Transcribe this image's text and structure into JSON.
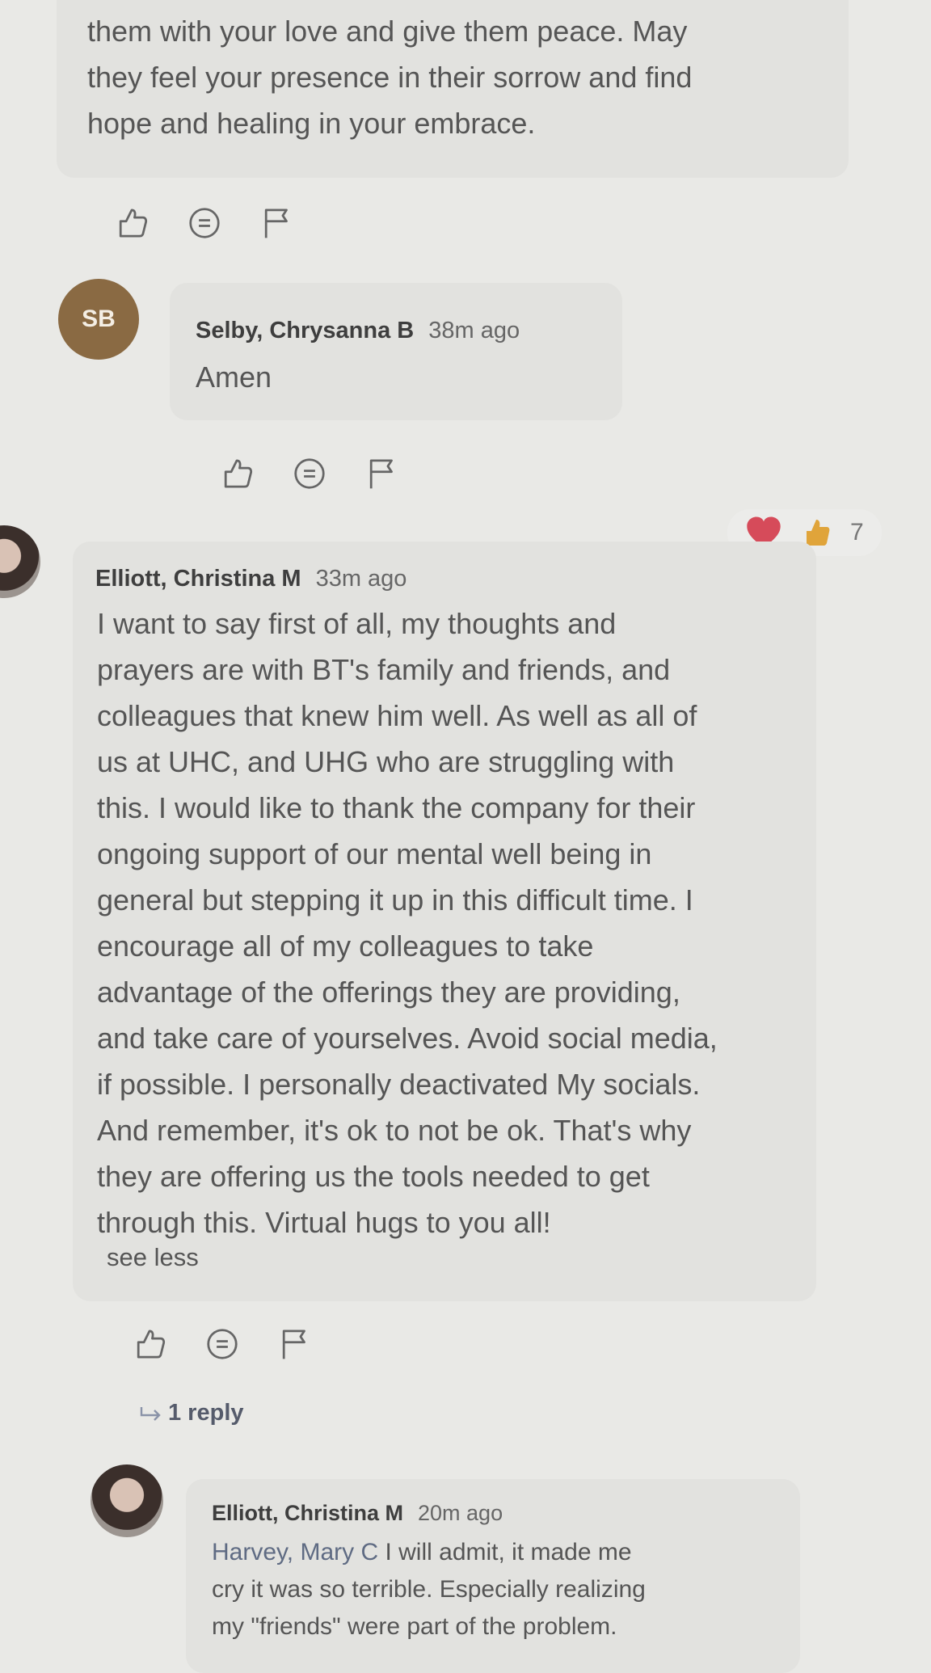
{
  "post_top": {
    "lines": [
      "them with your love and give them peace. May",
      "they feel your presence in their sorrow and find",
      "hope and healing in your embrace."
    ]
  },
  "comment_selby": {
    "initials": "SB",
    "author": "Selby, Chrysanna B",
    "time": "38m ago",
    "text": "Amen"
  },
  "comment_elliott": {
    "author": "Elliott, Christina M",
    "time": "33m ago",
    "reaction_count": "7",
    "lines": [
      "I want to say first of all, my thoughts and",
      "prayers are with BT's family and friends, and",
      "colleagues that knew him well. As well as all of",
      "us at UHC, and UHG who are struggling with",
      "this. I would like to thank the company for their",
      "ongoing support of our mental well being in",
      "general but stepping it up in this difficult time. I",
      "encourage all of my colleagues to take",
      "advantage of the offerings they  are providing,",
      "and take care of yourselves. Avoid social media,",
      "if possible. I personally deactivated My socials.",
      "And remember, it's ok to not be ok. That's why",
      "they are offering us the tools needed to get",
      "through this. Virtual hugs to you all!"
    ],
    "see_less": "see less",
    "replies_link": "1 reply"
  },
  "reply_elliott": {
    "author": "Elliott, Christina M",
    "time": "20m ago",
    "mention": "Harvey, Mary C",
    "line1_rest": " I will admit, it made me",
    "line2": "cry it was so terrible. Especially realizing",
    "line3": "my \"friends\" were part of the problem."
  },
  "colors": {
    "background": "#e9e9e6",
    "bubble": "#e2e2df",
    "avatar_sb": "#8a6a43",
    "heart": "#d64b5a",
    "thumb": "#e0a43a"
  },
  "icons": [
    "like-icon",
    "reply-icon",
    "flag-icon",
    "heart-reaction-icon",
    "thumbs-up-reaction-icon",
    "reply-arrow-icon"
  ]
}
